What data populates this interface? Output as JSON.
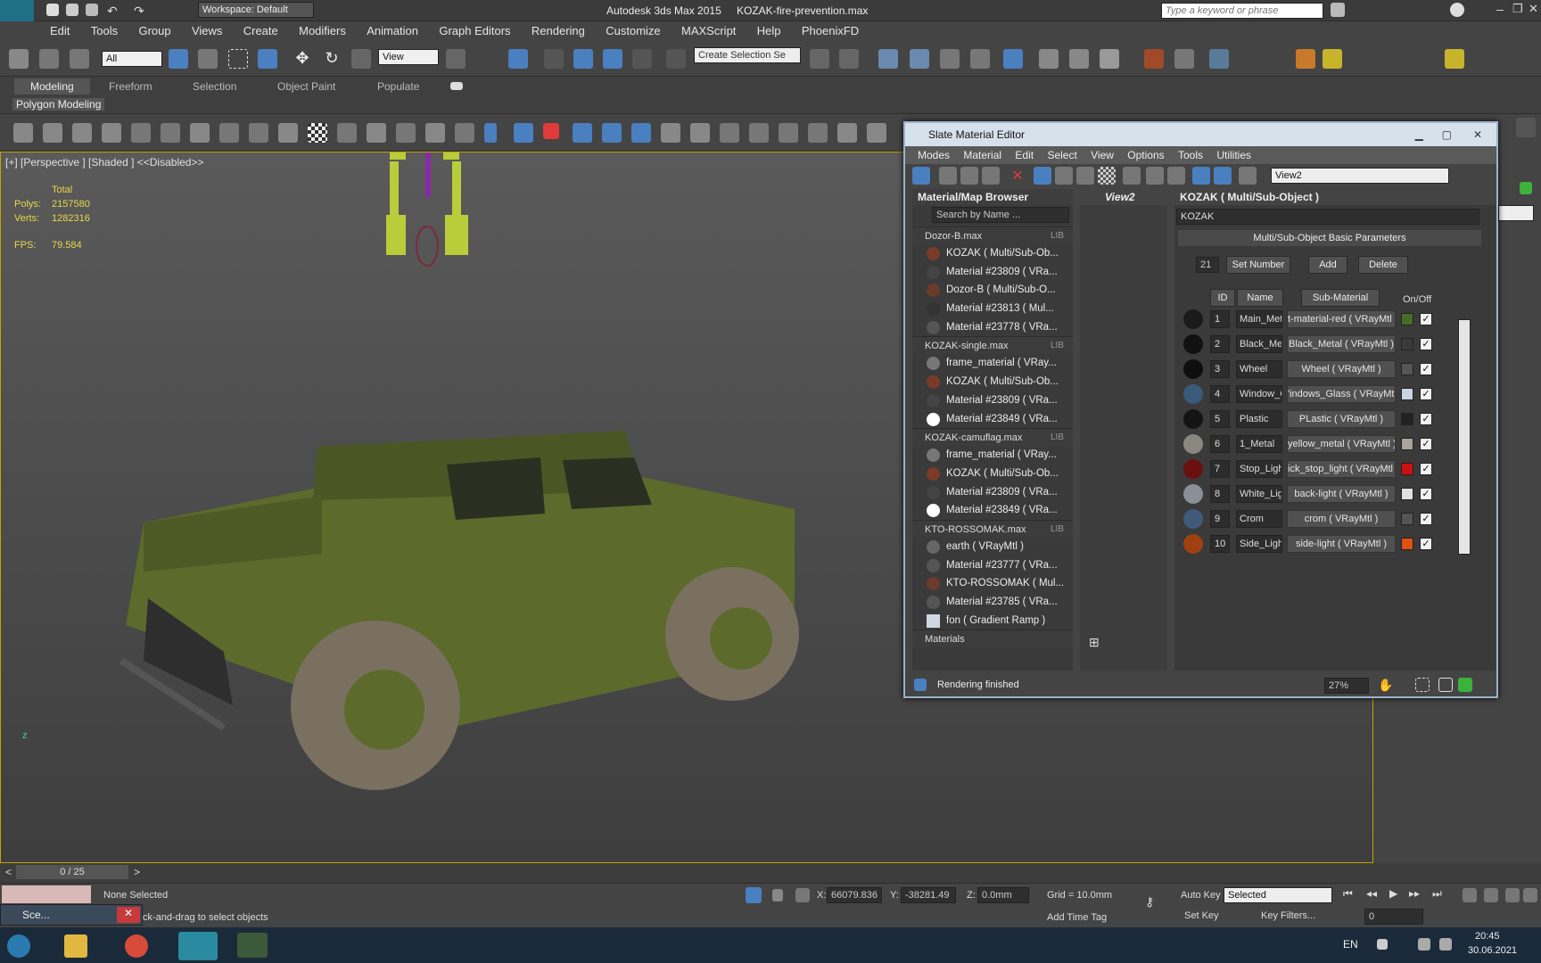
{
  "app": {
    "title": "Autodesk 3ds Max 2015",
    "filename": "KOZAK-fire-prevention.max",
    "workspace": "Workspace: Default",
    "search_placeholder": "Type a keyword or phrase",
    "logo": "MAX"
  },
  "menu": [
    "Edit",
    "Tools",
    "Group",
    "Views",
    "Create",
    "Modifiers",
    "Animation",
    "Graph Editors",
    "Rendering",
    "Customize",
    "MAXScript",
    "Help",
    "PhoenixFD"
  ],
  "toolbar": {
    "filter": "All",
    "ref_coord": "View",
    "selection_set": "Create Selection Se"
  },
  "ribbon": {
    "tabs": [
      "Modeling",
      "Freeform",
      "Selection",
      "Object Paint",
      "Populate"
    ],
    "subtab": "Polygon Modeling"
  },
  "viewport": {
    "label": "[+] [Perspective ] [Shaded ]  <<Disabled>>",
    "stats": {
      "total": "Total",
      "polys_label": "Polys:",
      "polys": "2157580",
      "verts_label": "Verts:",
      "verts": "1282316",
      "fps_label": "FPS:",
      "fps": "79.584"
    },
    "axis_z": "z"
  },
  "sme": {
    "title": "Slate Material Editor",
    "menu": [
      "Modes",
      "Material",
      "Edit",
      "Select",
      "View",
      "Options",
      "Tools",
      "Utilities"
    ],
    "view_select": "View2",
    "browser_title": "Material/Map Browser",
    "search_placeholder": "Search by Name ...",
    "groups": [
      {
        "name": "Dozor-B.max",
        "lib": "LIB",
        "items": [
          {
            "label": "KOZAK  ( Multi/Sub-Ob...",
            "color": "#7a3a2a"
          },
          {
            "label": "Material #23809  ( VRa...",
            "color": "#444444"
          },
          {
            "label": "Dozor-B  ( Multi/Sub-O...",
            "color": "#6a3a2a"
          },
          {
            "label": "Material #23813  ( Mul...",
            "color": "#333333"
          },
          {
            "label": "Material #23778  ( VRa...",
            "color": "#555555"
          }
        ]
      },
      {
        "name": "KOZAK-single.max",
        "lib": "LIB",
        "items": [
          {
            "label": "frame_material  ( VRay...",
            "color": "#777777"
          },
          {
            "label": "KOZAK  ( Multi/Sub-Ob...",
            "color": "#7a3a2a"
          },
          {
            "label": "Material #23809  ( VRa...",
            "color": "#444444"
          },
          {
            "label": "Material #23849  ( VRa...",
            "color": "#ffffff"
          }
        ]
      },
      {
        "name": "KOZAK-camuflag.max",
        "lib": "LIB",
        "items": [
          {
            "label": "frame_material  ( VRay...",
            "color": "#777777"
          },
          {
            "label": "KOZAK  ( Multi/Sub-Ob...",
            "color": "#7a3a2a"
          },
          {
            "label": "Material #23809  ( VRa...",
            "color": "#444444"
          },
          {
            "label": "Material #23849  ( VRa...",
            "color": "#ffffff"
          }
        ]
      },
      {
        "name": "KTO-ROSSOMAK.max",
        "lib": "LIB",
        "items": [
          {
            "label": "earth  ( VRayMtl )",
            "color": "#666666"
          },
          {
            "label": "Material #23777  ( VRa...",
            "color": "#555555"
          },
          {
            "label": "KTO-ROSSOMAK  ( Mul...",
            "color": "#6a3a2a"
          },
          {
            "label": "Material #23785  ( VRa...",
            "color": "#555555"
          },
          {
            "label": "fon  ( Gradient Ramp )",
            "color": "#cfd8e0"
          }
        ]
      }
    ],
    "more_group": "Materials",
    "view_tab": "View2",
    "props_title": "KOZAK  ( Multi/Sub-Object )",
    "name_field": "KOZAK",
    "rollout": "Multi/Sub-Object Basic Parameters",
    "count": "21",
    "set_number": "Set Number",
    "add": "Add",
    "delete": "Delete",
    "headers": {
      "id": "ID",
      "name": "Name",
      "sub": "Sub-Material",
      "onoff": "On/Off"
    },
    "rows": [
      {
        "id": "1",
        "name": "Main_Meta",
        "sub": "t-material-red  ( VRayMtl )",
        "color": "#4a6a28",
        "ball": "#1a1a1a"
      },
      {
        "id": "2",
        "name": "Black_Meta",
        "sub": "Black_Metal  ( VRayMtl )",
        "color": "#3a3a3a",
        "ball": "#111111"
      },
      {
        "id": "3",
        "name": "Wheel",
        "sub": "Wheel  ( VRayMtl )",
        "color": "#555555",
        "ball": "#0e0e0e"
      },
      {
        "id": "4",
        "name": "Window_G",
        "sub": "'indows_Glass  ( VRayMtl )",
        "color": "#c8d4e0",
        "ball": "#3a5a7a"
      },
      {
        "id": "5",
        "name": "Plastic",
        "sub": "PLastic  ( VRayMtl )",
        "color": "#222222",
        "ball": "#141414"
      },
      {
        "id": "6",
        "name": "1_Metal",
        "sub": "yellow_metal  ( VRayMtl )",
        "color": "#a8a49a",
        "ball": "#8a8680"
      },
      {
        "id": "7",
        "name": "Stop_Light",
        "sub": "ick_stop_light  ( VRayMtl )",
        "color": "#cc1010",
        "ball": "#6a1010"
      },
      {
        "id": "8",
        "name": "White_Ligh",
        "sub": "back-light  ( VRayMtl )",
        "color": "#e0e0e0",
        "ball": "#8a9098"
      },
      {
        "id": "9",
        "name": "Crom",
        "sub": "crom  ( VRayMtl )",
        "color": "#555555",
        "ball": "#405a7a"
      },
      {
        "id": "10",
        "name": "Side_Light",
        "sub": "side-light  ( VRayMtl )",
        "color": "#e05010",
        "ball": "#a04010"
      }
    ],
    "status": "Rendering finished",
    "zoom": "27%"
  },
  "timeline": {
    "frame": "0 / 25"
  },
  "status": {
    "selected": "None Selected",
    "prompt": "ck-and-drag to select objects",
    "x_label": "X:",
    "x": "66079.836",
    "y_label": "Y:",
    "y": "-38281.49",
    "z_label": "Z:",
    "z": "0.0mm",
    "grid": "Grid = 10.0mm",
    "add_time_tag": "Add Time Tag",
    "auto_key": "Auto Key",
    "set_key": "Set Key",
    "key_mode": "Selected",
    "key_filters": "Key Filters...",
    "frame_field": "0"
  },
  "taskbar": {
    "scene_btn": "Sce...",
    "language": "EN",
    "time": "20:45",
    "date": "30.06.2021"
  }
}
